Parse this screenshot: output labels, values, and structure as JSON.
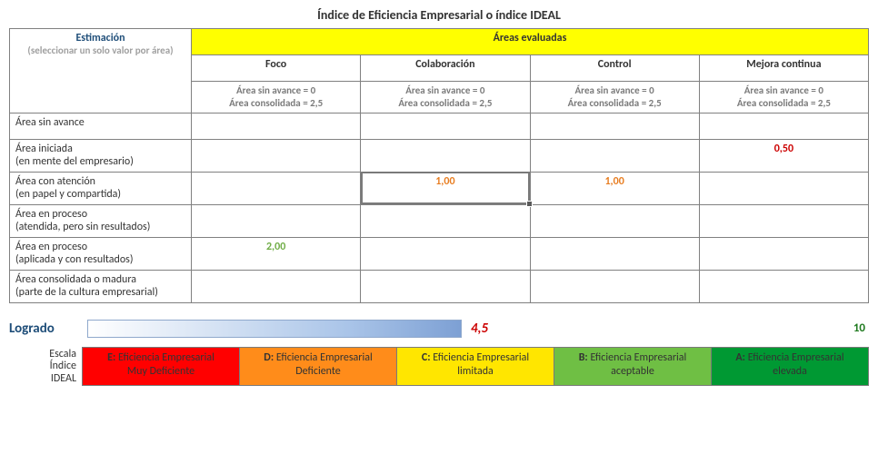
{
  "title": "Índice de Eficiencia Empresarial o índice IDEAL",
  "estimacion": {
    "head": "Estimación",
    "sub": "(seleccionar un solo valor por área)"
  },
  "areas_header": "Áreas evaluadas",
  "columns": [
    {
      "label": "Foco",
      "hint1": "Área sin avance = 0",
      "hint2": "Área consolidada = 2,5"
    },
    {
      "label": "Colaboración",
      "hint1": "Área sin avance = 0",
      "hint2": "Área consolidada = 2,5"
    },
    {
      "label": "Control",
      "hint1": "Área sin avance = 0",
      "hint2": "Área consolidada = 2,5"
    },
    {
      "label": "Mejora continua",
      "hint1": "Área sin avance = 0",
      "hint2": "Área consolidada = 2,5"
    }
  ],
  "rows": [
    {
      "label": "Área sin avance",
      "values": [
        "",
        "",
        "",
        ""
      ]
    },
    {
      "label": "Área iniciada\n(en mente del empresario)",
      "values": [
        "",
        "",
        "",
        "0,50"
      ]
    },
    {
      "label": "Área con atención\n(en papel y compartida)",
      "values": [
        "",
        "1,00",
        "1,00",
        ""
      ]
    },
    {
      "label": "Área en proceso\n(atendida, pero sin resultados)",
      "values": [
        "",
        "",
        "",
        ""
      ]
    },
    {
      "label": "Área en proceso\n(aplicada y con resultados)",
      "values": [
        "2,00",
        "",
        "",
        ""
      ]
    },
    {
      "label": "Área consolidada o madura\n(parte de la cultura empresarial)",
      "values": [
        "",
        "",
        "",
        ""
      ]
    }
  ],
  "value_colors": {
    "0,50": "val-red",
    "1,00": "val-orange",
    "2,00": "val-green"
  },
  "selected_cell": {
    "row": 2,
    "col": 1
  },
  "logrado": {
    "label": "Logrado",
    "value": "4,5",
    "max": "10"
  },
  "scale": {
    "label": "Escala Índice IDEAL",
    "items": [
      {
        "letter": "E",
        "text": "Eficiencia Empresarial Muy Deficiente",
        "cls": "sc-E"
      },
      {
        "letter": "D",
        "text": "Eficiencia Empresarial Deficiente",
        "cls": "sc-D"
      },
      {
        "letter": "C",
        "text": "Eficiencia Empresarial limitada",
        "cls": "sc-C"
      },
      {
        "letter": "B",
        "text": "Eficiencia Empresarial aceptable",
        "cls": "sc-B"
      },
      {
        "letter": "A",
        "text": "Eficiencia Empresarial elevada",
        "cls": "sc-A"
      }
    ]
  }
}
